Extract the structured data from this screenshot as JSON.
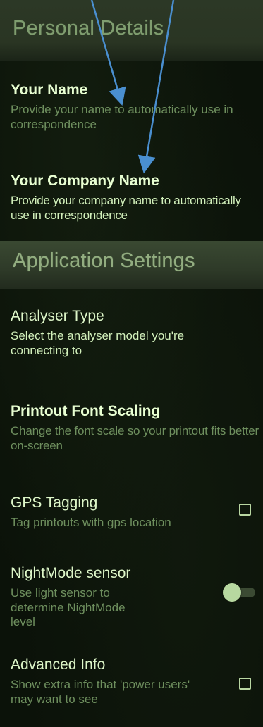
{
  "sections": {
    "personal": {
      "header": "Personal Details",
      "name": {
        "title": "Your Name",
        "summary": "Provide your name to automatically use in correspondence"
      },
      "company": {
        "title": "Your Company Name",
        "summary": "Provide your company name to automatically use in correspondence"
      }
    },
    "application": {
      "header": "Application Settings",
      "analyser": {
        "title": "Analyser Type",
        "summary": "Select the analyser model you're connecting to"
      },
      "font_scaling": {
        "title": "Printout Font Scaling",
        "summary": "Change the font scale so your printout fits better on-screen"
      },
      "gps": {
        "title": "GPS Tagging",
        "summary": "Tag printouts with gps location",
        "checked": false
      },
      "nightmode": {
        "title": "NightMode sensor",
        "summary": "Use light sensor to determine NightMode level",
        "enabled": false
      },
      "advanced": {
        "title": "Advanced Info",
        "summary": "Show extra info that 'power users' may want to see",
        "checked": false
      }
    }
  },
  "annotation": {
    "arrow_color": "#4a8fd0"
  }
}
